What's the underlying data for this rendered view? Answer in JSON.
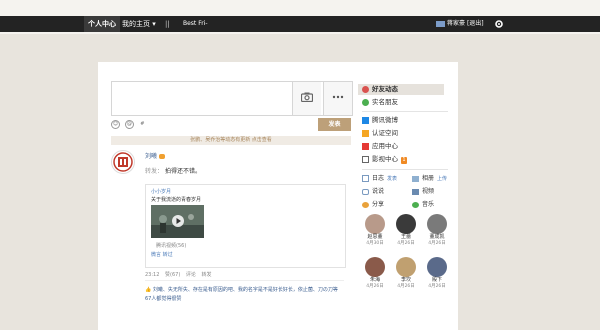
{
  "nav": {
    "home": "个人中心",
    "main_page": "我的主页 ▾",
    "separator": "||",
    "friend_text": "Best Fri-",
    "user": "蒋家豪",
    "logout": "[退出]"
  },
  "compose": {
    "post_label": "发表",
    "notice": "张鹏、吴乔治等动态有更新 点击查看"
  },
  "feed": {
    "author": "刘曦",
    "share_label": "转发：",
    "share_text": "拍得还不错。",
    "card_title": "小小岁月",
    "card_sub": "关于我流逝的青春岁月",
    "card_meta": "腾讯视频(56)",
    "card_tags": "微言  转过",
    "time": "23:12",
    "like": "赞(67)",
    "comment": "评论",
    "forward": "转发",
    "likes_text": "刘曦、失无所失、存在是有原因的吧、我的名字是不是好长好长，依止菌、刀の刀等67人都觉得很赞"
  },
  "sidebar": {
    "menu": [
      {
        "label": "好友动态",
        "icon": "friends-feed-icon",
        "color": "#d9534f"
      },
      {
        "label": "实名朋友",
        "icon": "realname-icon",
        "color": "#4caf50"
      },
      {
        "label": "腾讯微博",
        "icon": "weibo-icon",
        "color": "#1e88e5"
      },
      {
        "label": "认证空间",
        "icon": "verified-icon",
        "color": "#f5a623"
      },
      {
        "label": "应用中心",
        "icon": "app-center-icon",
        "color": "#e53935"
      },
      {
        "label": "影视中心",
        "icon": "video-center-icon",
        "color": "#666666",
        "badge": "1"
      }
    ],
    "mini": [
      {
        "label": "日志",
        "sub": "发表",
        "icon": "blog-icon"
      },
      {
        "label": "相册",
        "sub": "上传",
        "icon": "album-icon"
      },
      {
        "label": "说说",
        "sub": "",
        "icon": "talk-icon"
      },
      {
        "label": "视频",
        "sub": "",
        "icon": "video-icon"
      },
      {
        "label": "分享",
        "sub": "",
        "icon": "share-icon"
      },
      {
        "label": "音乐",
        "sub": "",
        "icon": "music-icon"
      }
    ],
    "friends": [
      {
        "name": "赵思董",
        "date": "4月30日",
        "color": "#b89a8a"
      },
      {
        "name": "王蕾",
        "date": "4月26日",
        "color": "#3a3a3a"
      },
      {
        "name": "董成凯",
        "date": "4月26日",
        "color": "#7a7a7a"
      },
      {
        "name": "朱海",
        "date": "4月26日",
        "color": "#8a5a4a"
      },
      {
        "name": "李坎",
        "date": "4月26日",
        "color": "#c0a070"
      },
      {
        "name": "殿下",
        "date": "4月26日",
        "color": "#5a6a8a"
      }
    ]
  }
}
